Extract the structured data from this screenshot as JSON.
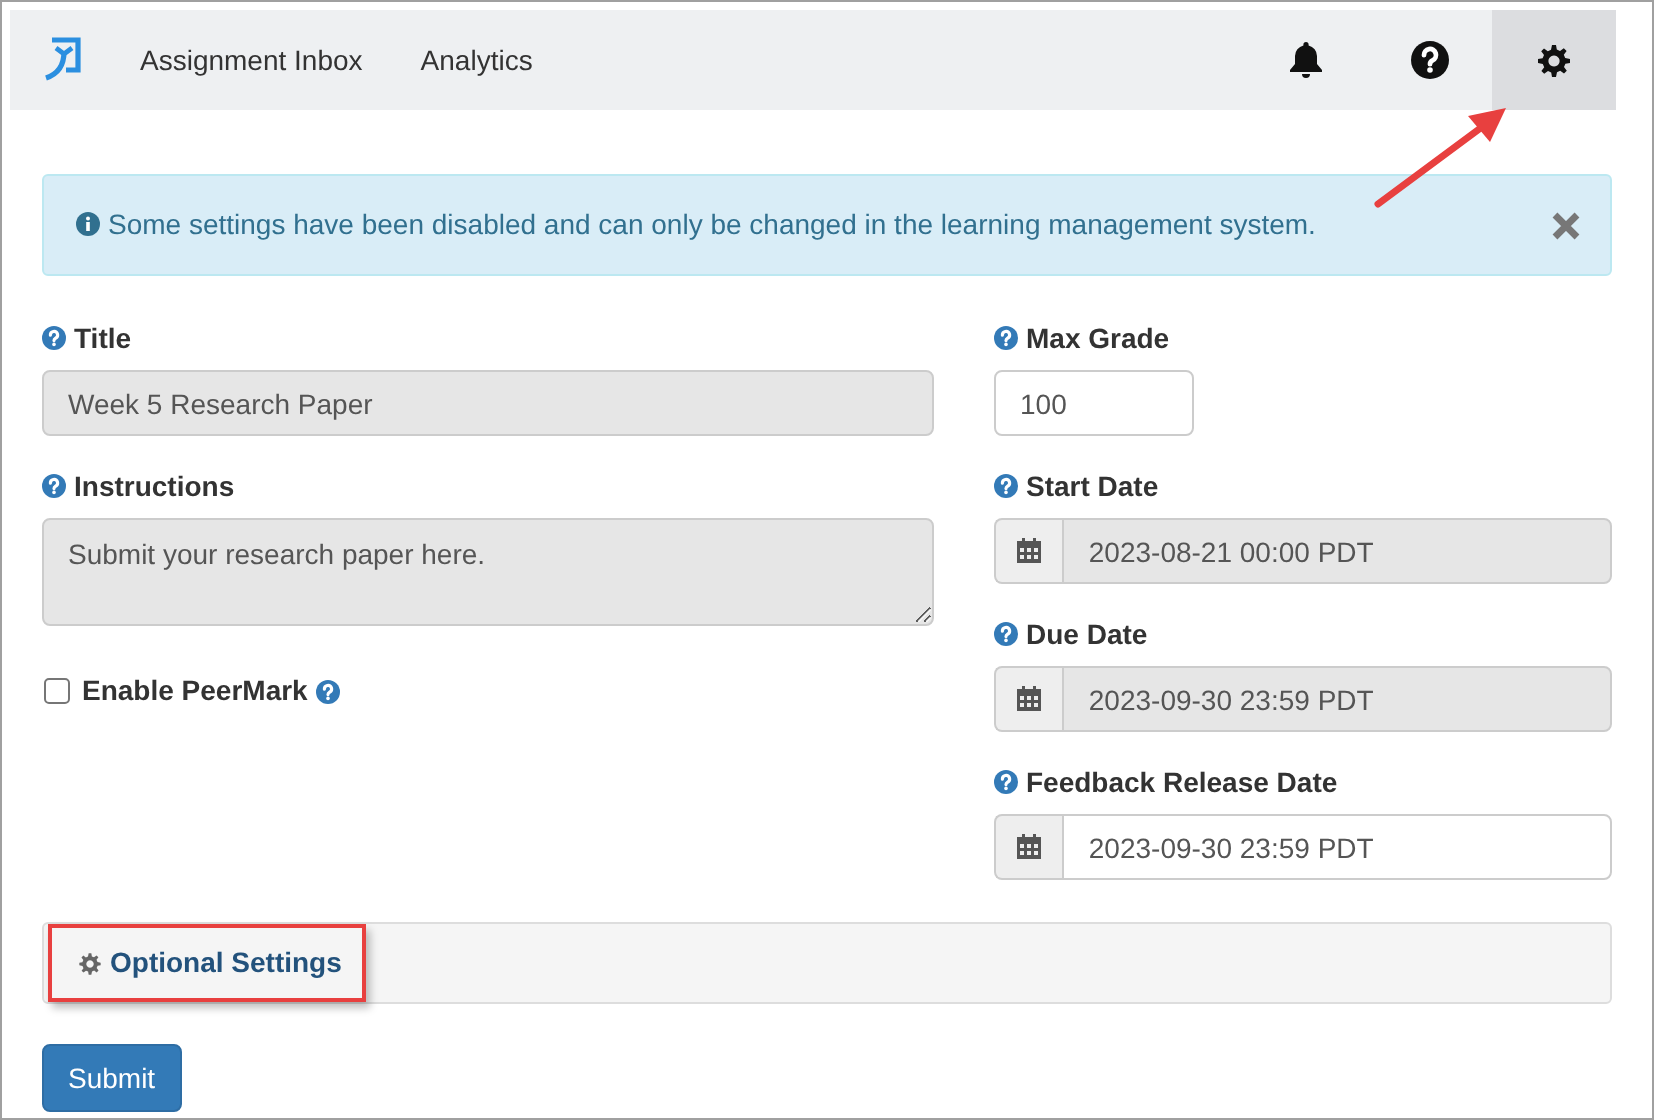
{
  "navbar": {
    "links": [
      {
        "label": "Assignment Inbox"
      },
      {
        "label": "Analytics"
      }
    ],
    "icons": [
      {
        "kind": "bell",
        "selected": false
      },
      {
        "kind": "help",
        "selected": false
      },
      {
        "kind": "gear",
        "selected": true
      }
    ]
  },
  "alert": {
    "text": "Some settings have been disabled and can only be changed in the learning management system."
  },
  "left_fields": [
    {
      "kind": "text",
      "label": "Title",
      "value": "Week 5 Research Paper",
      "disabled": true
    },
    {
      "kind": "textarea",
      "label": "Instructions",
      "value": "Submit your research paper here.",
      "disabled": true
    },
    {
      "kind": "checkbox",
      "label": "Enable PeerMark",
      "checked": false
    }
  ],
  "right_fields": [
    {
      "kind": "number",
      "label": "Max Grade",
      "value": "100",
      "disabled": false
    },
    {
      "kind": "date",
      "label": "Start Date",
      "value": "2023-08-21 00:00 PDT",
      "disabled": true
    },
    {
      "kind": "date",
      "label": "Due Date",
      "value": "2023-09-30 23:59 PDT",
      "disabled": true
    },
    {
      "kind": "date",
      "label": "Feedback Release Date",
      "value": "2023-09-30 23:59 PDT",
      "disabled": false
    }
  ],
  "optional_settings": {
    "label": "Optional Settings",
    "highlighted": true
  },
  "submit": {
    "label": "Submit"
  },
  "callout_arrow": true
}
